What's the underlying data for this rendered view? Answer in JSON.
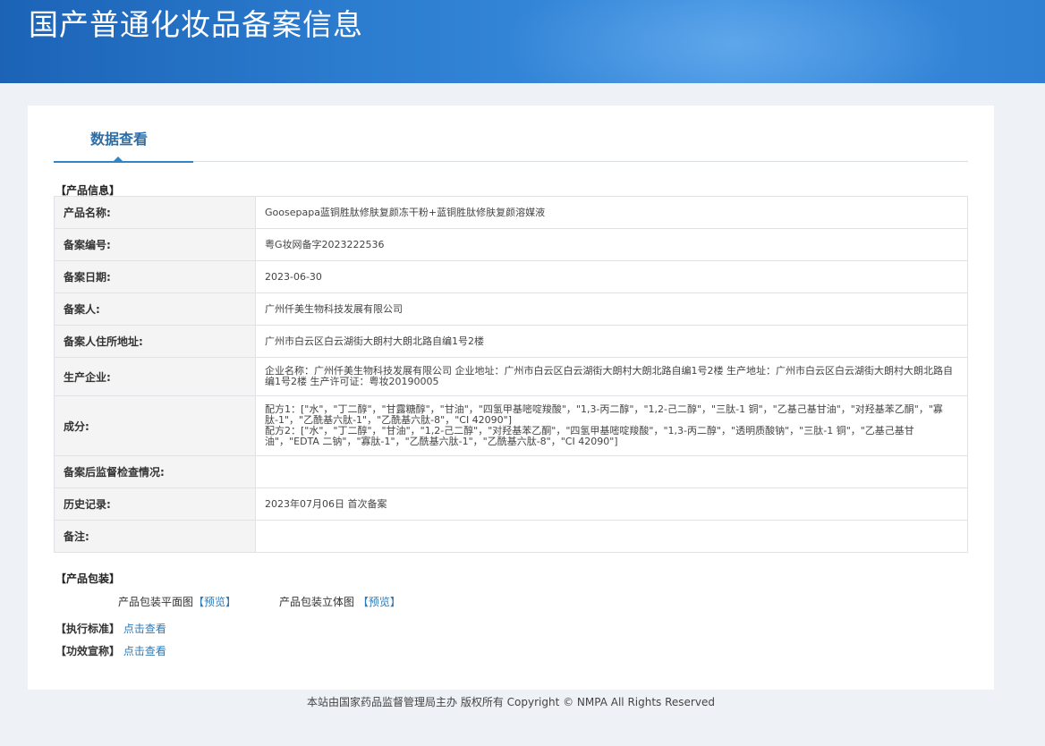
{
  "header": {
    "title": "国产普通化妆品备案信息"
  },
  "tab": {
    "label": "数据查看"
  },
  "product_info": {
    "section_title": "【产品信息】",
    "rows": [
      {
        "key": "产品名称:",
        "value": "Goosepapa蓝铜胜肽修肤复颜冻干粉+蓝铜胜肽修肤复颜溶媒液"
      },
      {
        "key": "备案编号:",
        "value": "粤G妆网备字2023222536"
      },
      {
        "key": "备案日期:",
        "value": "2023-06-30"
      },
      {
        "key": "备案人:",
        "value": "广州仟美生物科技发展有限公司"
      },
      {
        "key": "备案人住所地址:",
        "value": "广州市白云区白云湖街大朗村大朗北路自编1号2楼"
      },
      {
        "key": "生产企业:",
        "value": "企业名称：广州仟美生物科技发展有限公司 企业地址：广州市白云区白云湖街大朗村大朗北路自编1号2楼 生产地址：广州市白云区白云湖街大朗村大朗北路自编1号2楼 生产许可证：粤妆20190005"
      },
      {
        "key": "成分:",
        "value": "配方1：[\"水\"，\"丁二醇\"，\"甘露糖醇\"，\"甘油\"，\"四氢甲基嘧啶羧酸\"，\"1,3-丙二醇\"，\"1,2-己二醇\"，\"三肽-1 铜\"，\"乙基己基甘油\"，\"对羟基苯乙酮\"，\"寡肽-1\"，\"乙酰基六肽-1\"，\"乙酰基六肽-8\"，\"CI 42090\"]",
        "value2": "配方2：[\"水\"，\"丁二醇\"，\"甘油\"，\"1,2-己二醇\"，\"对羟基苯乙酮\"，\"四氢甲基嘧啶羧酸\"，\"1,3-丙二醇\"，\"透明质酸钠\"，\"三肽-1 铜\"，\"乙基己基甘油\"，\"EDTA 二钠\"，\"寡肽-1\"，\"乙酰基六肽-1\"，\"乙酰基六肽-8\"，\"CI 42090\"]"
      },
      {
        "key": "备案后监督检查情况:",
        "value": ""
      },
      {
        "key": "历史记录:",
        "value": "2023年07月06日 首次备案"
      },
      {
        "key": "备注:",
        "value": ""
      }
    ]
  },
  "packaging": {
    "section_title": "【产品包装】",
    "flat_label": "产品包装平面图",
    "flat_link": "【预览】",
    "stereo_label": "产品包装立体图",
    "stereo_link": "【预览】"
  },
  "standard": {
    "section_title": "【执行标准】",
    "link": "点击查看"
  },
  "efficacy": {
    "section_title": "【功效宣称】",
    "link": "点击查看"
  },
  "footer": {
    "text": "本站由国家药品监督管理局主办 版权所有 Copyright © NMPA All Rights Reserved"
  }
}
